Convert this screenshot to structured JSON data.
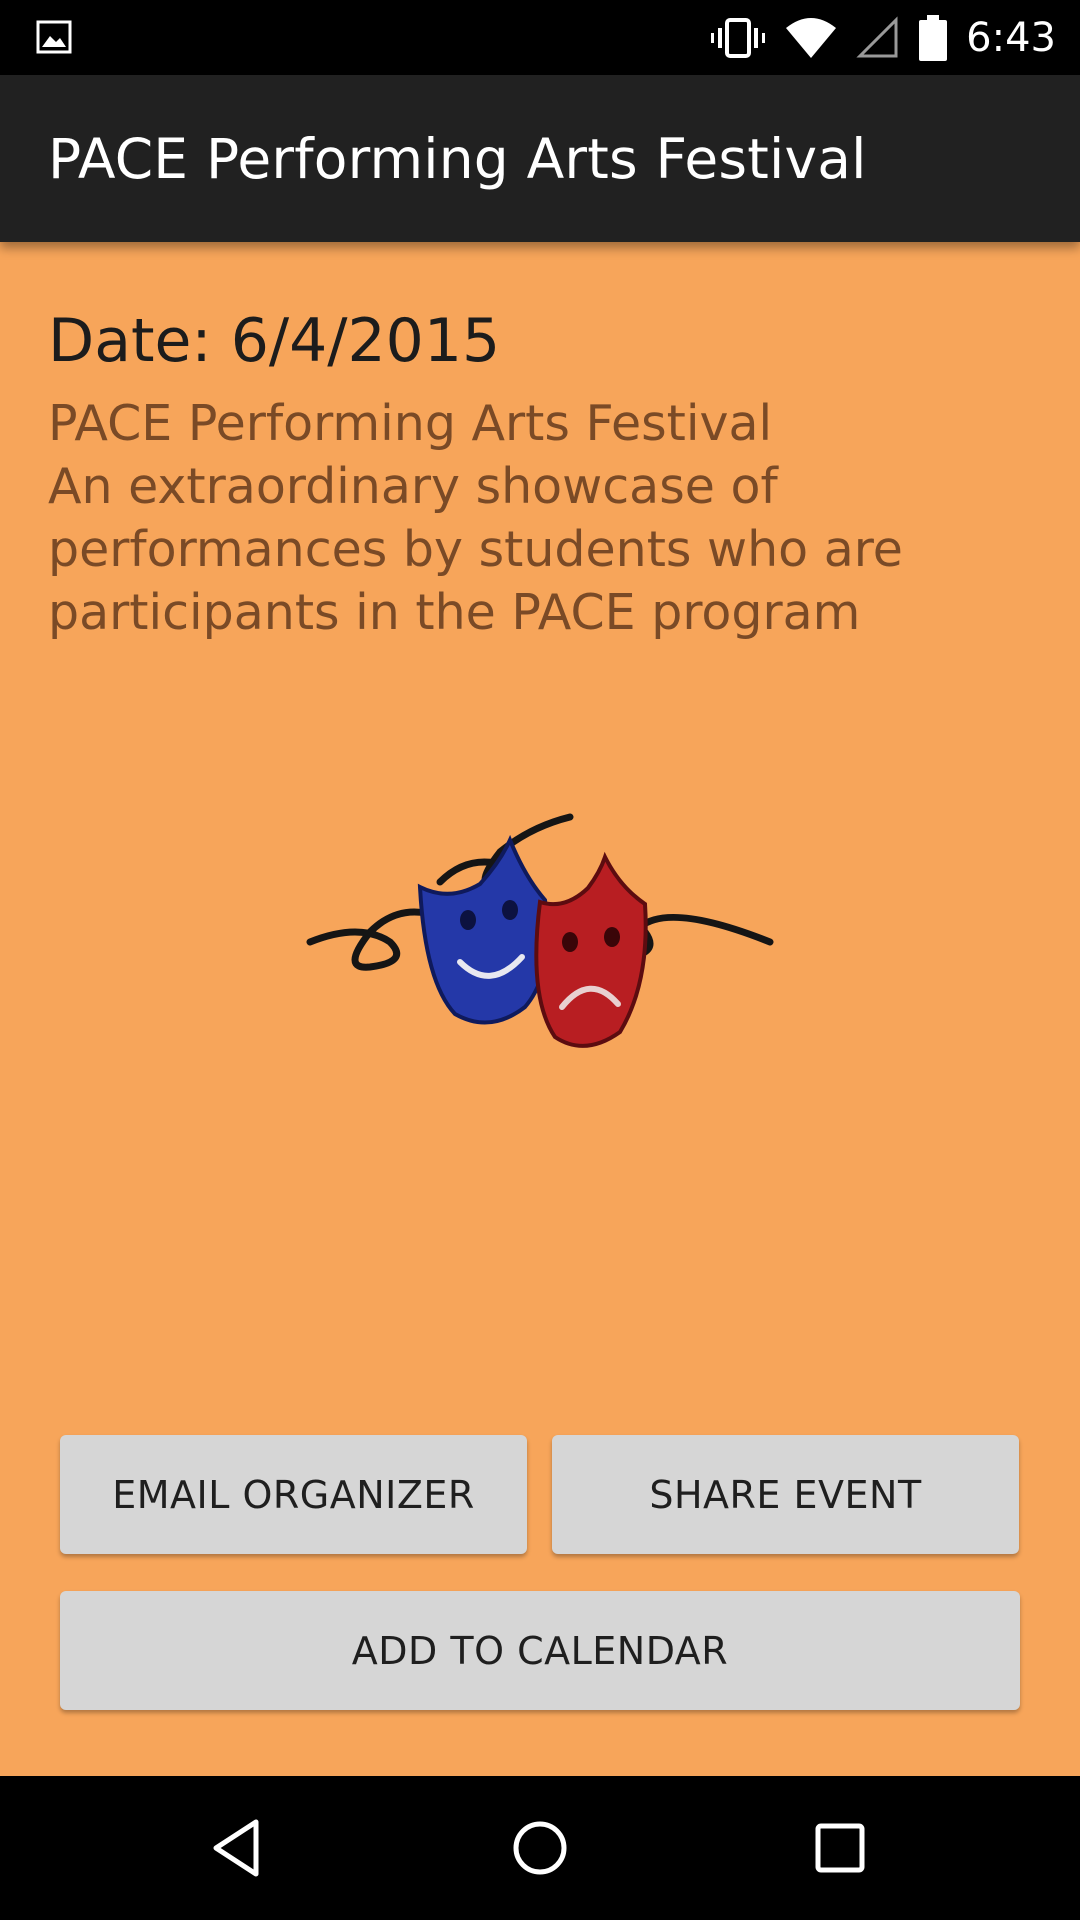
{
  "status_bar": {
    "time": "6:43",
    "icons": [
      "image-notification-icon",
      "vibrate-icon",
      "wifi-icon",
      "cell-signal-icon",
      "battery-icon"
    ]
  },
  "app_bar": {
    "title": "PACE Performing Arts Festival"
  },
  "event": {
    "date": "Date: 6/4/2015",
    "description": "PACE Performing Arts Festival\nAn extraordinary showcase of performances by students who are participants in the PACE program",
    "image": "theater-masks-icon"
  },
  "actions": {
    "email_label": "EMAIL ORGANIZER",
    "share_label": "SHARE EVENT",
    "calendar_label": "ADD TO CALENDAR"
  },
  "nav_bar": {
    "icons": [
      "back-icon",
      "home-icon",
      "recents-icon"
    ]
  },
  "colors": {
    "background": "#f7a55a",
    "app_bar": "#212121",
    "button": "#d6d6d6",
    "description_text": "#7a4a26"
  }
}
